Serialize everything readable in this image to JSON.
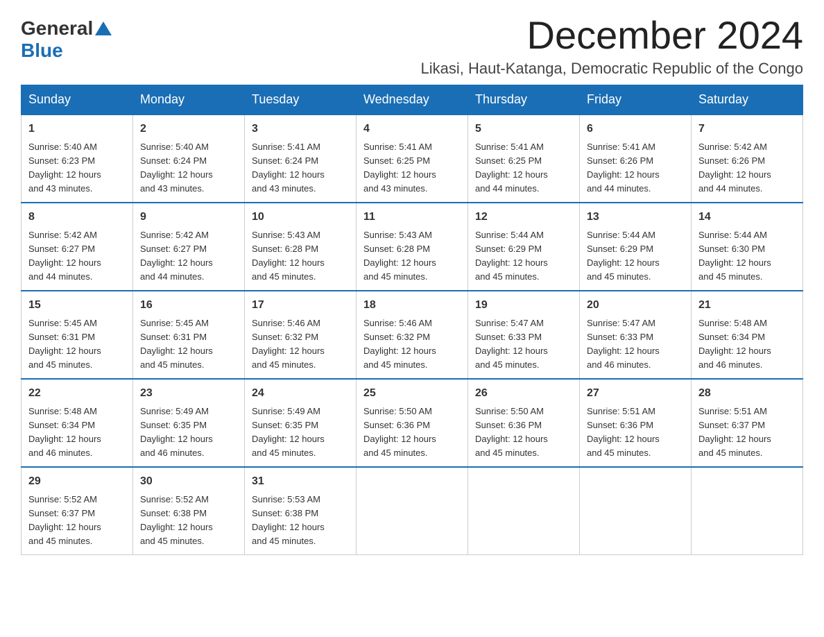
{
  "logo": {
    "general": "General",
    "blue": "Blue"
  },
  "title": "December 2024",
  "subtitle": "Likasi, Haut-Katanga, Democratic Republic of the Congo",
  "headers": [
    "Sunday",
    "Monday",
    "Tuesday",
    "Wednesday",
    "Thursday",
    "Friday",
    "Saturday"
  ],
  "weeks": [
    [
      {
        "day": "1",
        "sunrise": "5:40 AM",
        "sunset": "6:23 PM",
        "daylight": "12 hours and 43 minutes."
      },
      {
        "day": "2",
        "sunrise": "5:40 AM",
        "sunset": "6:24 PM",
        "daylight": "12 hours and 43 minutes."
      },
      {
        "day": "3",
        "sunrise": "5:41 AM",
        "sunset": "6:24 PM",
        "daylight": "12 hours and 43 minutes."
      },
      {
        "day": "4",
        "sunrise": "5:41 AM",
        "sunset": "6:25 PM",
        "daylight": "12 hours and 43 minutes."
      },
      {
        "day": "5",
        "sunrise": "5:41 AM",
        "sunset": "6:25 PM",
        "daylight": "12 hours and 44 minutes."
      },
      {
        "day": "6",
        "sunrise": "5:41 AM",
        "sunset": "6:26 PM",
        "daylight": "12 hours and 44 minutes."
      },
      {
        "day": "7",
        "sunrise": "5:42 AM",
        "sunset": "6:26 PM",
        "daylight": "12 hours and 44 minutes."
      }
    ],
    [
      {
        "day": "8",
        "sunrise": "5:42 AM",
        "sunset": "6:27 PM",
        "daylight": "12 hours and 44 minutes."
      },
      {
        "day": "9",
        "sunrise": "5:42 AM",
        "sunset": "6:27 PM",
        "daylight": "12 hours and 44 minutes."
      },
      {
        "day": "10",
        "sunrise": "5:43 AM",
        "sunset": "6:28 PM",
        "daylight": "12 hours and 45 minutes."
      },
      {
        "day": "11",
        "sunrise": "5:43 AM",
        "sunset": "6:28 PM",
        "daylight": "12 hours and 45 minutes."
      },
      {
        "day": "12",
        "sunrise": "5:44 AM",
        "sunset": "6:29 PM",
        "daylight": "12 hours and 45 minutes."
      },
      {
        "day": "13",
        "sunrise": "5:44 AM",
        "sunset": "6:29 PM",
        "daylight": "12 hours and 45 minutes."
      },
      {
        "day": "14",
        "sunrise": "5:44 AM",
        "sunset": "6:30 PM",
        "daylight": "12 hours and 45 minutes."
      }
    ],
    [
      {
        "day": "15",
        "sunrise": "5:45 AM",
        "sunset": "6:31 PM",
        "daylight": "12 hours and 45 minutes."
      },
      {
        "day": "16",
        "sunrise": "5:45 AM",
        "sunset": "6:31 PM",
        "daylight": "12 hours and 45 minutes."
      },
      {
        "day": "17",
        "sunrise": "5:46 AM",
        "sunset": "6:32 PM",
        "daylight": "12 hours and 45 minutes."
      },
      {
        "day": "18",
        "sunrise": "5:46 AM",
        "sunset": "6:32 PM",
        "daylight": "12 hours and 45 minutes."
      },
      {
        "day": "19",
        "sunrise": "5:47 AM",
        "sunset": "6:33 PM",
        "daylight": "12 hours and 45 minutes."
      },
      {
        "day": "20",
        "sunrise": "5:47 AM",
        "sunset": "6:33 PM",
        "daylight": "12 hours and 46 minutes."
      },
      {
        "day": "21",
        "sunrise": "5:48 AM",
        "sunset": "6:34 PM",
        "daylight": "12 hours and 46 minutes."
      }
    ],
    [
      {
        "day": "22",
        "sunrise": "5:48 AM",
        "sunset": "6:34 PM",
        "daylight": "12 hours and 46 minutes."
      },
      {
        "day": "23",
        "sunrise": "5:49 AM",
        "sunset": "6:35 PM",
        "daylight": "12 hours and 46 minutes."
      },
      {
        "day": "24",
        "sunrise": "5:49 AM",
        "sunset": "6:35 PM",
        "daylight": "12 hours and 45 minutes."
      },
      {
        "day": "25",
        "sunrise": "5:50 AM",
        "sunset": "6:36 PM",
        "daylight": "12 hours and 45 minutes."
      },
      {
        "day": "26",
        "sunrise": "5:50 AM",
        "sunset": "6:36 PM",
        "daylight": "12 hours and 45 minutes."
      },
      {
        "day": "27",
        "sunrise": "5:51 AM",
        "sunset": "6:36 PM",
        "daylight": "12 hours and 45 minutes."
      },
      {
        "day": "28",
        "sunrise": "5:51 AM",
        "sunset": "6:37 PM",
        "daylight": "12 hours and 45 minutes."
      }
    ],
    [
      {
        "day": "29",
        "sunrise": "5:52 AM",
        "sunset": "6:37 PM",
        "daylight": "12 hours and 45 minutes."
      },
      {
        "day": "30",
        "sunrise": "5:52 AM",
        "sunset": "6:38 PM",
        "daylight": "12 hours and 45 minutes."
      },
      {
        "day": "31",
        "sunrise": "5:53 AM",
        "sunset": "6:38 PM",
        "daylight": "12 hours and 45 minutes."
      },
      null,
      null,
      null,
      null
    ]
  ],
  "labels": {
    "sunrise": "Sunrise:",
    "sunset": "Sunset:",
    "daylight": "Daylight:"
  }
}
